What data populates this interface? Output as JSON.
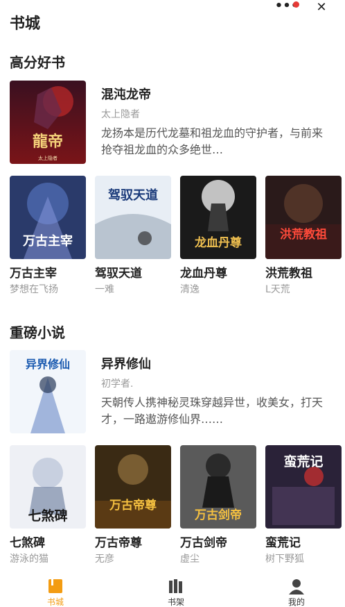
{
  "header": {
    "title": "书城",
    "more_icon": "•••",
    "close_icon": "✕"
  },
  "sections": [
    {
      "title": "高分好书",
      "featured": {
        "title": "混沌龙帝",
        "author": "太上隐者",
        "desc": "龙扬本是历代龙墓和祖龙血的守护者，与前来抢夺祖龙血的众多绝世…",
        "cover_text": "龍帝",
        "cover_sub": "太上隐者"
      },
      "books": [
        {
          "title": "万古主宰",
          "author": "梦想在飞扬",
          "cover_text": "万古主宰"
        },
        {
          "title": "驾驭天道",
          "author": "一难",
          "cover_text": "驾驭天道"
        },
        {
          "title": "龙血丹尊",
          "author": "清逸",
          "cover_text": "龙血丹尊"
        },
        {
          "title": "洪荒教祖",
          "author": "L天荒",
          "cover_text": "洪荒教祖"
        }
      ]
    },
    {
      "title": "重磅小说",
      "featured": {
        "title": "异界修仙",
        "author": "初学者.",
        "desc": "天朝传人携神秘灵珠穿越异世，收美女，打天才，一路遨游修仙界……",
        "cover_text": "异界修仙"
      },
      "books": [
        {
          "title": "七煞碑",
          "author": "游泳的猫",
          "cover_text": "七煞碑"
        },
        {
          "title": "万古帝尊",
          "author": "无彦",
          "cover_text": "万古帝尊"
        },
        {
          "title": "万古剑帝",
          "author": "虚尘",
          "cover_text": "万古剑帝"
        },
        {
          "title": "蛮荒记",
          "author": "树下野狐",
          "cover_text": "蛮荒记"
        }
      ]
    }
  ],
  "tabbar": [
    {
      "label": "书城",
      "icon": "bookstore-icon",
      "active": true
    },
    {
      "label": "书架",
      "icon": "bookshelf-icon",
      "active": false
    },
    {
      "label": "我的",
      "icon": "profile-icon",
      "active": false
    }
  ],
  "colors": {
    "accent": "#f39c12",
    "text": "#222222",
    "muted": "#999999",
    "desc": "#555555",
    "badge": "#e53935"
  }
}
